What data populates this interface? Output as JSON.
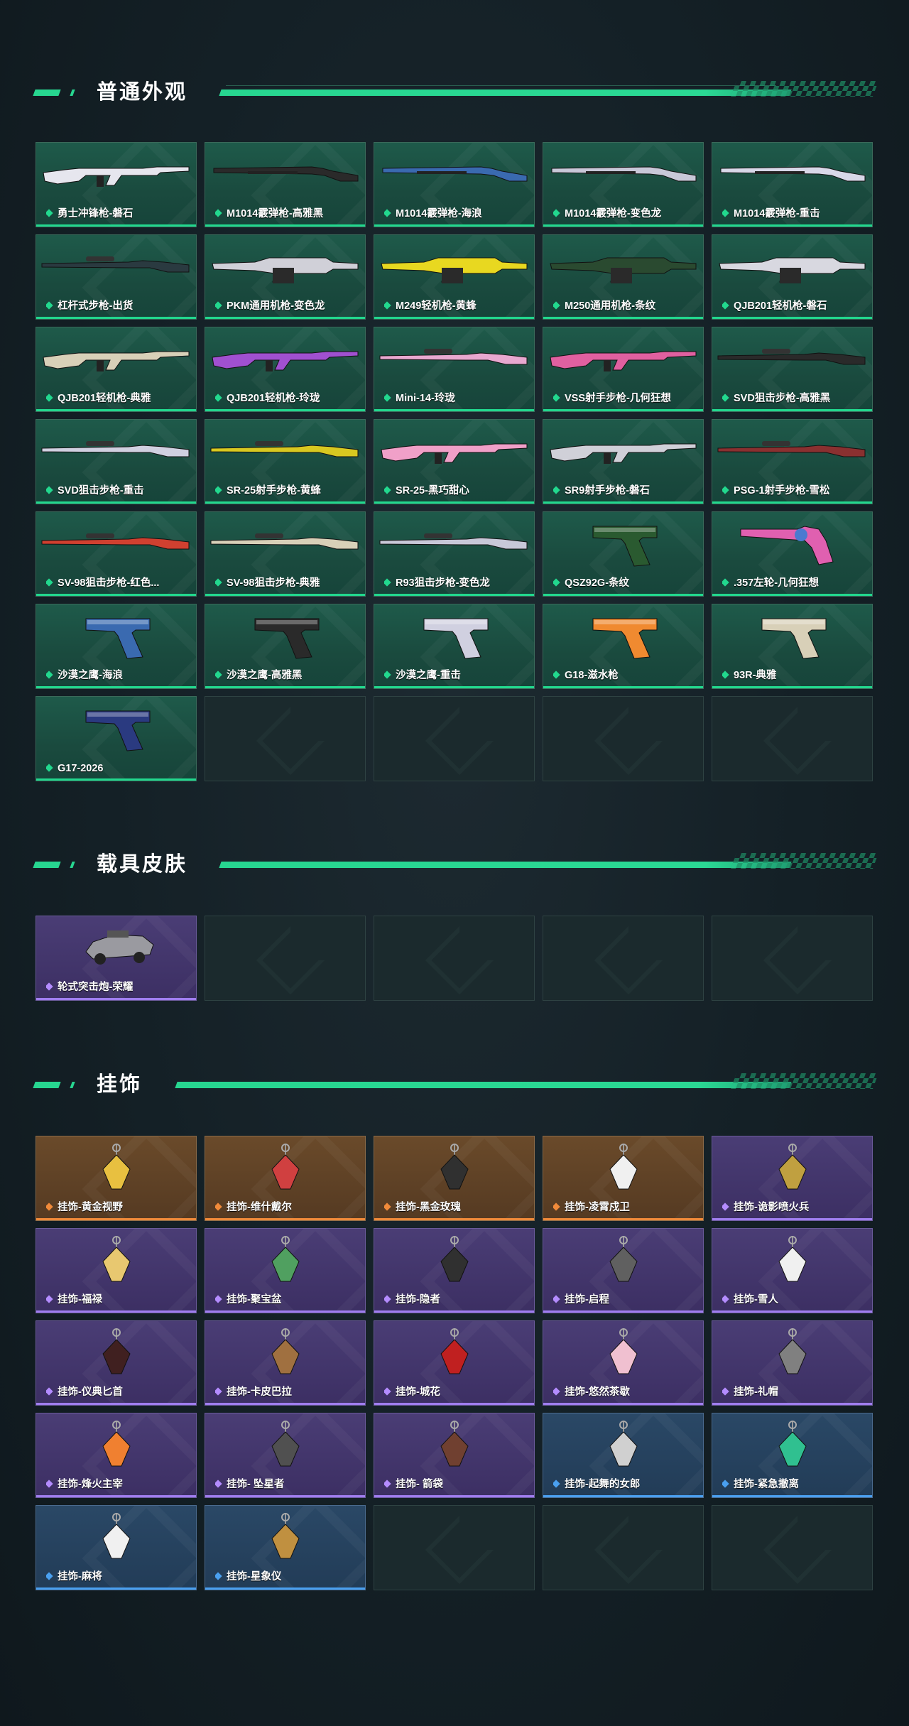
{
  "sections": {
    "normal": {
      "title": "普通外观",
      "items": [
        {
          "label": "勇士冲锋枪-磐石",
          "rarity": "green",
          "art": "rifle",
          "color": "#e6e6ee"
        },
        {
          "label": "M1014霰弹枪-高雅黑",
          "rarity": "green",
          "art": "shotgun",
          "color": "#2a2a2a"
        },
        {
          "label": "M1014霰弹枪-海浪",
          "rarity": "green",
          "art": "shotgun",
          "color": "#3a6ab0"
        },
        {
          "label": "M1014霰弹枪-变色龙",
          "rarity": "green",
          "art": "shotgun",
          "color": "#c8c8d8"
        },
        {
          "label": "M1014霰弹枪-重击",
          "rarity": "green",
          "art": "shotgun",
          "color": "#d8d8e8"
        },
        {
          "label": "杠杆式步枪-出货",
          "rarity": "green",
          "art": "sniper",
          "color": "#2a3a40"
        },
        {
          "label": "PKM通用机枪-变色龙",
          "rarity": "green",
          "art": "lmg",
          "color": "#d0d0d8"
        },
        {
          "label": "M249轻机枪-黄蜂",
          "rarity": "green",
          "art": "lmg",
          "color": "#e8d820"
        },
        {
          "label": "M250通用机枪-条纹",
          "rarity": "green",
          "art": "lmg",
          "color": "#2a4a30"
        },
        {
          "label": "QJB201轻机枪-磐石",
          "rarity": "green",
          "art": "lmg",
          "color": "#d8d8e0"
        },
        {
          "label": "QJB201轻机枪-典雅",
          "rarity": "green",
          "art": "rifle",
          "color": "#d8d0b8"
        },
        {
          "label": "QJB201轻机枪-玲珑",
          "rarity": "green",
          "art": "rifle",
          "color": "#a050d0"
        },
        {
          "label": "Mini-14-玲珑",
          "rarity": "green",
          "art": "sniper",
          "color": "#e8a8d0"
        },
        {
          "label": "VSS射手步枪-几何狂想",
          "rarity": "green",
          "art": "rifle",
          "color": "#e060a0"
        },
        {
          "label": "SVD狙击步枪-高雅黑",
          "rarity": "green",
          "art": "sniper",
          "color": "#2a2a2a"
        },
        {
          "label": "SVD狙击步枪-重击",
          "rarity": "green",
          "art": "sniper",
          "color": "#d0d0e0"
        },
        {
          "label": "SR-25射手步枪-黄蜂",
          "rarity": "green",
          "art": "sniper",
          "color": "#d8c820"
        },
        {
          "label": "SR-25-黑巧甜心",
          "rarity": "green",
          "art": "rifle",
          "color": "#f0a0c8"
        },
        {
          "label": "SR9射手步枪-磐石",
          "rarity": "green",
          "art": "rifle",
          "color": "#d0d0d8"
        },
        {
          "label": "PSG-1射手步枪-雪松",
          "rarity": "green",
          "art": "sniper",
          "color": "#8a3030"
        },
        {
          "label": "SV-98狙击步枪-红色...",
          "rarity": "green",
          "art": "sniper",
          "color": "#d04030"
        },
        {
          "label": "SV-98狙击步枪-典雅",
          "rarity": "green",
          "art": "sniper",
          "color": "#d8d0b8"
        },
        {
          "label": "R93狙击步枪-变色龙",
          "rarity": "green",
          "art": "sniper",
          "color": "#c8c8d8"
        },
        {
          "label": "QSZ92G-条纹",
          "rarity": "green",
          "art": "pistol",
          "color": "#2a5a30"
        },
        {
          "label": ".357左轮-几何狂想",
          "rarity": "green",
          "art": "revolver",
          "color": "#e060b0"
        },
        {
          "label": "沙漠之鹰-海浪",
          "rarity": "green",
          "art": "pistol",
          "color": "#3a6ab0"
        },
        {
          "label": "沙漠之鹰-高雅黑",
          "rarity": "green",
          "art": "pistol",
          "color": "#2a2a2a"
        },
        {
          "label": "沙漠之鹰-重击",
          "rarity": "green",
          "art": "pistol",
          "color": "#d0d0e0"
        },
        {
          "label": "G18-滋水枪",
          "rarity": "green",
          "art": "pistol",
          "color": "#f08a30"
        },
        {
          "label": "93R-典雅",
          "rarity": "green",
          "art": "pistol",
          "color": "#d8d0b8"
        },
        {
          "label": "G17-2026",
          "rarity": "green",
          "art": "pistol",
          "color": "#2a3a80"
        }
      ]
    },
    "vehicle": {
      "title": "载具皮肤",
      "items": [
        {
          "label": "轮式突击炮-荣耀",
          "rarity": "purple",
          "art": "vehicle",
          "color": "#9a9aa0"
        }
      ]
    },
    "charms": {
      "title": "挂饰",
      "items": [
        {
          "label": "挂饰-黄金视野",
          "rarity": "orange",
          "art": "charm",
          "color": "#e8c040"
        },
        {
          "label": "挂饰-维什戴尔",
          "rarity": "orange",
          "art": "charm",
          "color": "#d04040"
        },
        {
          "label": "挂饰-黑金玫瑰",
          "rarity": "orange",
          "art": "charm",
          "color": "#303030"
        },
        {
          "label": "挂饰-凌霄戍卫",
          "rarity": "orange",
          "art": "charm",
          "color": "#f0f0f0"
        },
        {
          "label": "挂饰-诡影喷火兵",
          "rarity": "purple",
          "art": "charm",
          "color": "#c0a040"
        },
        {
          "label": "挂饰-福禄",
          "rarity": "purple",
          "art": "charm",
          "color": "#e8c870"
        },
        {
          "label": "挂饰-聚宝盆",
          "rarity": "purple",
          "art": "charm",
          "color": "#50a060"
        },
        {
          "label": "挂饰-隐者",
          "rarity": "purple",
          "art": "charm",
          "color": "#303030"
        },
        {
          "label": "挂饰-启程",
          "rarity": "purple",
          "art": "charm",
          "color": "#606060"
        },
        {
          "label": "挂饰-雪人",
          "rarity": "purple",
          "art": "charm",
          "color": "#f0f0f0"
        },
        {
          "label": "挂饰-仪典匕首",
          "rarity": "purple",
          "art": "charm",
          "color": "#402020"
        },
        {
          "label": "挂饰-卡皮巴拉",
          "rarity": "purple",
          "art": "charm",
          "color": "#a07040"
        },
        {
          "label": "挂饰-城花",
          "rarity": "purple",
          "art": "charm",
          "color": "#c02020"
        },
        {
          "label": "挂饰-悠然茶歇",
          "rarity": "purple",
          "art": "charm",
          "color": "#f0c0d0"
        },
        {
          "label": "挂饰-礼帽",
          "rarity": "purple",
          "art": "charm",
          "color": "#808080"
        },
        {
          "label": "挂饰-烽火主宰",
          "rarity": "purple",
          "art": "charm",
          "color": "#f08030"
        },
        {
          "label": "挂饰- 坠星者",
          "rarity": "purple",
          "art": "charm",
          "color": "#505050"
        },
        {
          "label": "挂饰- 箭袋",
          "rarity": "purple",
          "art": "charm",
          "color": "#704030"
        },
        {
          "label": "挂饰-起舞的女郎",
          "rarity": "blue",
          "art": "charm",
          "color": "#d0d0d0"
        },
        {
          "label": "挂饰-紧急撤离",
          "rarity": "blue",
          "art": "charm",
          "color": "#30c090"
        },
        {
          "label": "挂饰-麻将",
          "rarity": "blue",
          "art": "charm",
          "color": "#f0f0f0"
        },
        {
          "label": "挂饰-星象仪",
          "rarity": "blue",
          "art": "charm",
          "color": "#c09040"
        }
      ]
    }
  }
}
